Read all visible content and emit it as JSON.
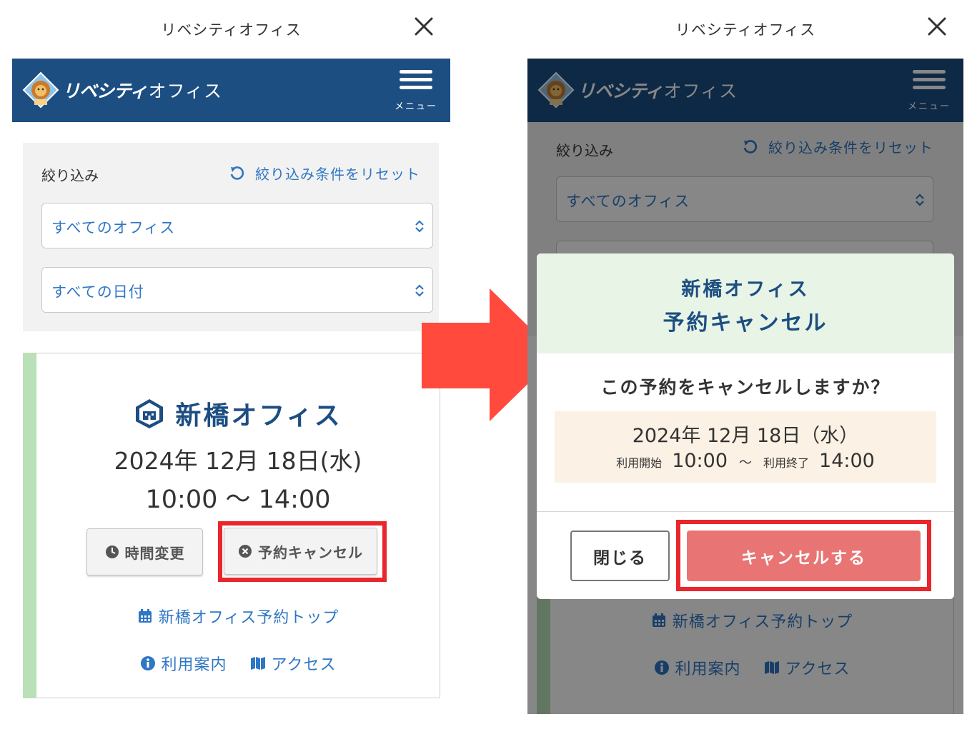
{
  "app_title": "リベシティオフィス",
  "brand": {
    "logo_text": "リベシティ",
    "name_text": "オフィス"
  },
  "menu_label": "メニュー",
  "filter": {
    "label": "絞り込み",
    "reset_label": "絞り込み条件をリセット",
    "office_select": "すべてのオフィス",
    "date_select": "すべての日付"
  },
  "reservation": {
    "office": "新橋オフィス",
    "date": "2024年 12月 18日(水)",
    "time": "10:00 〜 14:00",
    "change_time_label": "時間変更",
    "cancel_label": "予約キャンセル",
    "top_link": "新橋オフィス予約トップ",
    "guide_link": "利用案内",
    "access_link": "アクセス"
  },
  "modal": {
    "office": "新橋オフィス",
    "title": "予約キャンセル",
    "question": "この予約をキャンセルしますか？",
    "date": "2024年 12月 18日（水）",
    "start_label": "利用開始",
    "start_time": "10:00",
    "tilde": "〜",
    "end_label": "利用終了",
    "end_time": "14:00",
    "close_label": "閉じる",
    "confirm_label": "キャンセルする"
  },
  "colors": {
    "header_bg": "#1c4e82",
    "accent_blue": "#2f76c4",
    "highlight_red": "#e8262b",
    "arrow_red": "#ff4a3d",
    "confirm_button": "#e87573",
    "card_stripe": "#b9e0b7"
  }
}
